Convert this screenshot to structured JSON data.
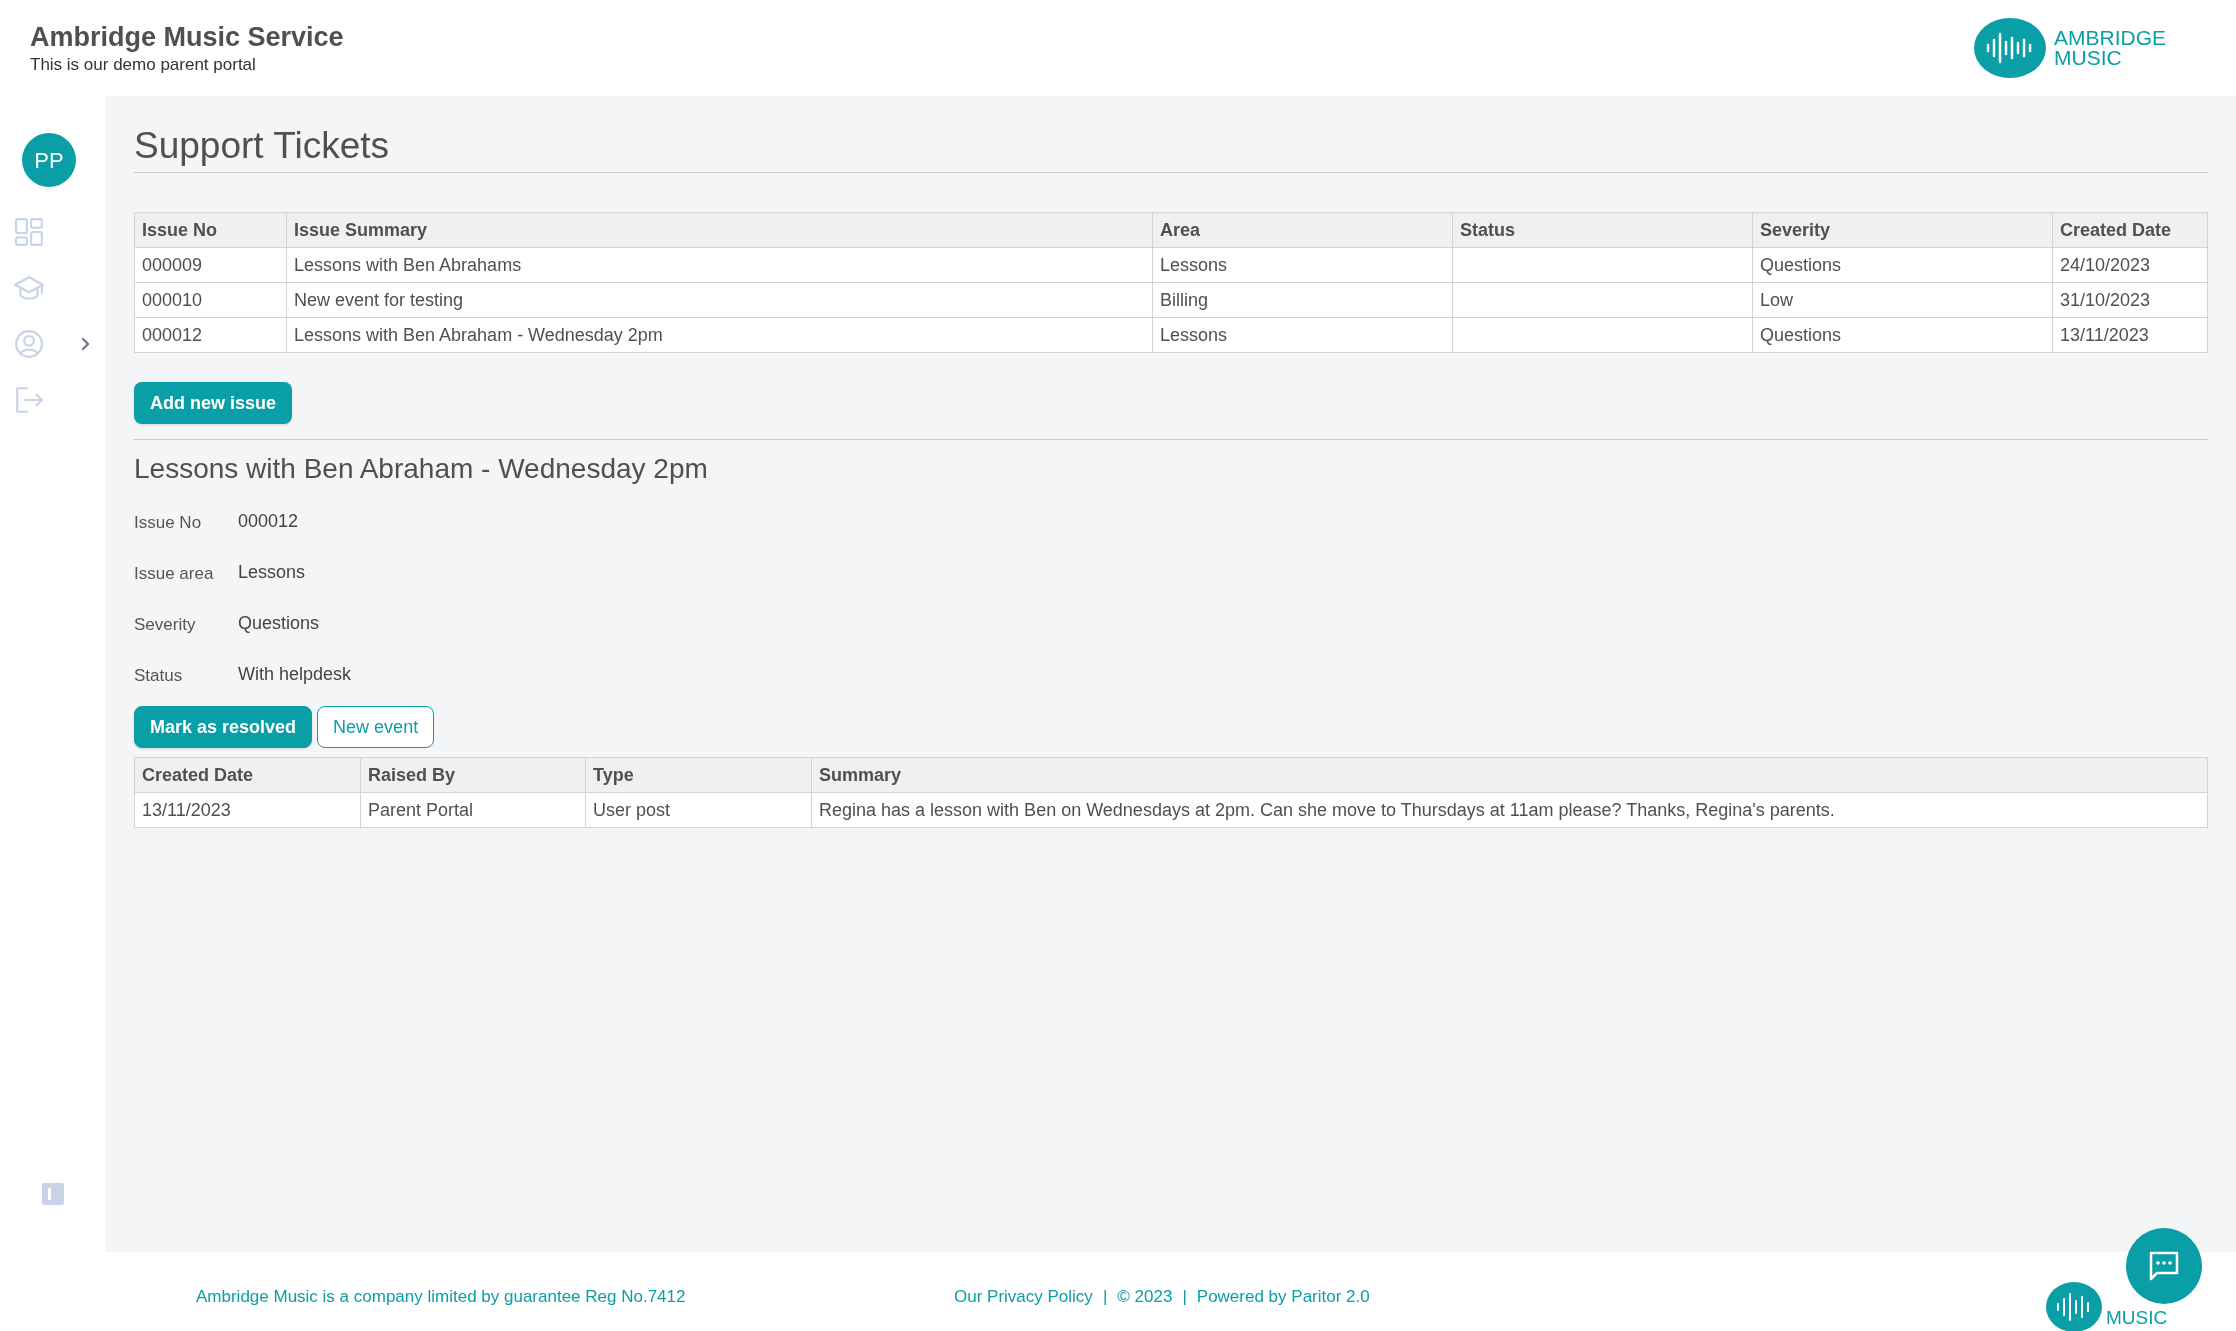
{
  "header": {
    "title": "Ambridge Music Service",
    "subtitle": "This is our demo parent portal",
    "logo": [
      "AMBRIDGE",
      "MUSIC"
    ]
  },
  "sidebar": {
    "avatar": "PP",
    "items": [
      {
        "kind": "dashboard",
        "expandable": false
      },
      {
        "kind": "lessons",
        "expandable": false
      },
      {
        "kind": "account",
        "expandable": true
      },
      {
        "kind": "logout",
        "expandable": false
      }
    ]
  },
  "page_title": "Support Tickets",
  "tickets": {
    "columns": [
      "Issue No",
      "Issue Summary",
      "Area",
      "Status",
      "Severity",
      "Created Date"
    ],
    "rows": [
      [
        "000009",
        "Lessons with Ben Abrahams",
        "Lessons",
        "",
        "Questions",
        "24/10/2023"
      ],
      [
        "000010",
        "New event for testing",
        "Billing",
        "",
        "Low",
        "31/10/2023"
      ],
      [
        "000012",
        "Lessons with Ben Abraham - Wednesday 2pm",
        "Lessons",
        "",
        "Questions",
        "13/11/2023"
      ]
    ]
  },
  "add_button": "Add new issue",
  "detail": {
    "title": "Lessons with Ben Abraham - Wednesday 2pm",
    "fields": [
      {
        "label": "Issue No",
        "value": "000012"
      },
      {
        "label": "Issue area",
        "value": "Lessons"
      },
      {
        "label": "Severity",
        "value": "Questions"
      },
      {
        "label": "Status",
        "value": "With helpdesk"
      }
    ],
    "buttons": [
      {
        "label": "Mark as resolved",
        "kind": "primary"
      },
      {
        "label": "New event",
        "kind": "outline"
      }
    ]
  },
  "events": {
    "columns": [
      "Created Date",
      "Raised By",
      "Type",
      "Summary"
    ],
    "rows": [
      [
        "13/11/2023",
        "Parent Portal",
        "User post",
        "Regina has a lesson with Ben on Wednesdays at 2pm. Can she move to Thursdays at 11am please? Thanks, Regina's parents."
      ]
    ]
  },
  "footer": {
    "company": "Ambridge Music is a company limited by guarantee Reg No.7412",
    "links": [
      "Our Privacy Policy",
      "|",
      "© 2023",
      "|",
      "Powered by Paritor 2.0"
    ],
    "logo": "MUSIC"
  }
}
